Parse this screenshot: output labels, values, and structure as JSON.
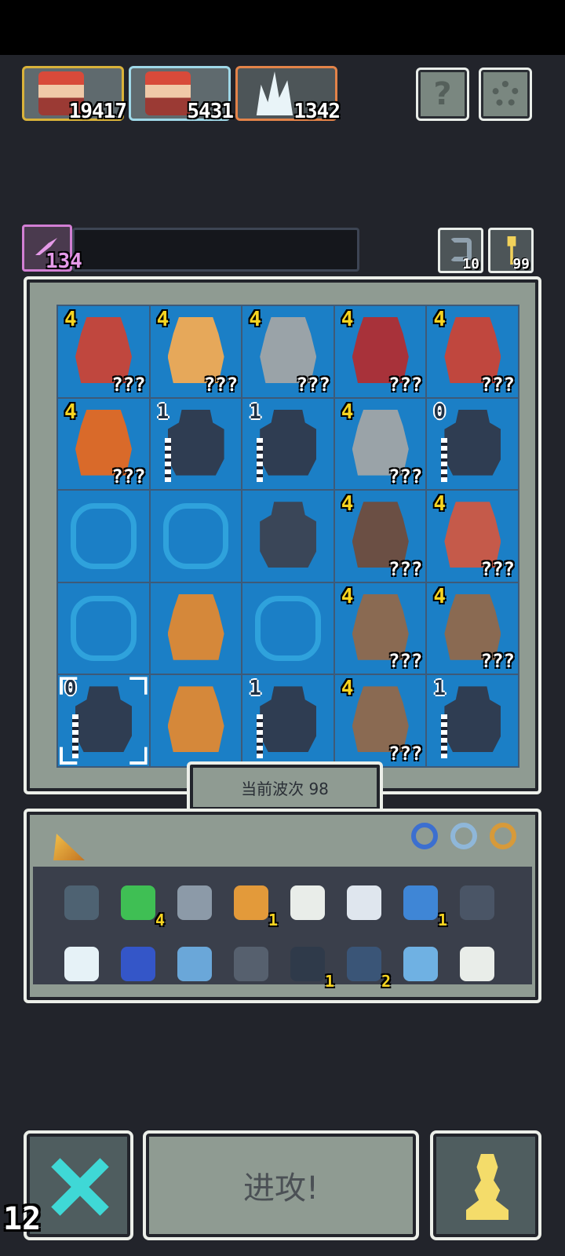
{
  "top_cards": [
    {
      "value": "19417",
      "icon": "monk-portrait"
    },
    {
      "value": "5431",
      "icon": "monk-portrait"
    },
    {
      "value": "1342",
      "icon": "ice-spike"
    }
  ],
  "top_buttons": {
    "help_label": "?",
    "settings_icon": "gear-icon"
  },
  "xp": {
    "value": "134",
    "icon": "winged-sword"
  },
  "mini_buttons": [
    {
      "value": "10",
      "icon": "undo-arrow"
    },
    {
      "value": "99",
      "icon": "key-icon"
    }
  ],
  "board": {
    "cells": [
      {
        "level": "4",
        "unit": "warrior-red-hat",
        "label": "???",
        "color": "#c0473e"
      },
      {
        "level": "4",
        "unit": "golden-knight",
        "label": "???",
        "color": "#e6a85a"
      },
      {
        "level": "4",
        "unit": "old-sage-axe",
        "label": "???",
        "color": "#9aa3a8"
      },
      {
        "level": "4",
        "unit": "red-armor-knight",
        "label": "???",
        "color": "#a8323a"
      },
      {
        "level": "4",
        "unit": "warrior-red-hat",
        "label": "???",
        "color": "#c0473e"
      },
      {
        "level": "4",
        "unit": "viking-dwarf",
        "label": "???",
        "color": "#d96a2a"
      },
      {
        "level": "1",
        "unit": "stone-golem",
        "label": "",
        "color": "#2f3d52",
        "white": true
      },
      {
        "level": "1",
        "unit": "stone-golem",
        "label": "",
        "color": "#2f3d52",
        "white": true
      },
      {
        "level": "4",
        "unit": "old-sage-axe",
        "label": "???",
        "color": "#9aa3a8"
      },
      {
        "level": "0",
        "unit": "stone-golem",
        "label": "",
        "color": "#2f3d52",
        "white": true
      },
      {
        "level": "",
        "unit": "",
        "label": "",
        "color": ""
      },
      {
        "level": "",
        "unit": "",
        "label": "",
        "color": ""
      },
      {
        "level": "",
        "unit": "stone-statue",
        "label": "",
        "color": "#3a4658"
      },
      {
        "level": "4",
        "unit": "dark-dwarf",
        "label": "???",
        "color": "#6b4f44"
      },
      {
        "level": "4",
        "unit": "red-bandana-dwarf",
        "label": "???",
        "color": "#c55a4a"
      },
      {
        "level": "",
        "unit": "",
        "label": "",
        "color": ""
      },
      {
        "level": "",
        "unit": "tribal-spearman",
        "label": "",
        "color": "#d5883a"
      },
      {
        "level": "",
        "unit": "",
        "label": "",
        "color": ""
      },
      {
        "level": "4",
        "unit": "shield-bearer",
        "label": "???",
        "color": "#8a6a52"
      },
      {
        "level": "4",
        "unit": "shield-bearer",
        "label": "???",
        "color": "#8a6a52"
      },
      {
        "level": "0",
        "unit": "stone-golem",
        "label": "",
        "color": "#2f3d52",
        "white": true
      },
      {
        "level": "",
        "unit": "tribal-spearman",
        "label": "",
        "color": "#d5883a"
      },
      {
        "level": "1",
        "unit": "stone-golem",
        "label": "",
        "color": "#2f3d52",
        "white": true
      },
      {
        "level": "4",
        "unit": "shield-bearer",
        "label": "???",
        "color": "#8a6a52"
      },
      {
        "level": "1",
        "unit": "stone-golem",
        "label": "",
        "color": "#2f3d52",
        "white": true
      }
    ],
    "wave_label": "当前波次 98"
  },
  "inventory": {
    "orbs": [
      "#3c6fd0",
      "#8fb7d9",
      "#d79a3a"
    ],
    "items": [
      {
        "icon": "shield-icon",
        "count": "",
        "color": "#4e6272"
      },
      {
        "icon": "emerald-icon",
        "count": "4",
        "color": "#3fbf54"
      },
      {
        "icon": "pickaxe-icon",
        "count": "",
        "color": "#8c9aa8"
      },
      {
        "icon": "bell-icon",
        "count": "1",
        "color": "#e39a3a"
      },
      {
        "icon": "hook-icon",
        "count": "",
        "color": "#e9ede9"
      },
      {
        "icon": "wing-icon",
        "count": "",
        "color": "#dfe6ee"
      },
      {
        "icon": "crystal-icon",
        "count": "1",
        "color": "#3f86d6"
      },
      {
        "icon": "gargoyle-icon",
        "count": "",
        "color": "#4a5566"
      },
      {
        "icon": "ice-spike-icon",
        "count": "",
        "color": "#e6f2f7"
      },
      {
        "icon": "cauldron-icon",
        "count": "",
        "color": "#3456c8"
      },
      {
        "icon": "scroll-icon",
        "count": "",
        "color": "#6aa7d9"
      },
      {
        "icon": "sword-icon",
        "count": "",
        "color": "#56606e"
      },
      {
        "icon": "orb-cluster-icon",
        "count": "1",
        "color": "#2f3a4a"
      },
      {
        "icon": "pagoda-icon",
        "count": "2",
        "color": "#3a5577"
      },
      {
        "icon": "chain-icon",
        "count": "",
        "color": "#6fb1e3"
      },
      {
        "icon": "battle-axe-icon",
        "count": "",
        "color": "#e9ede9"
      }
    ]
  },
  "bottom": {
    "cancel_icon": "x-icon",
    "attack_label": "进攻!",
    "pawn_icon": "pawn-icon",
    "counter": "12"
  }
}
